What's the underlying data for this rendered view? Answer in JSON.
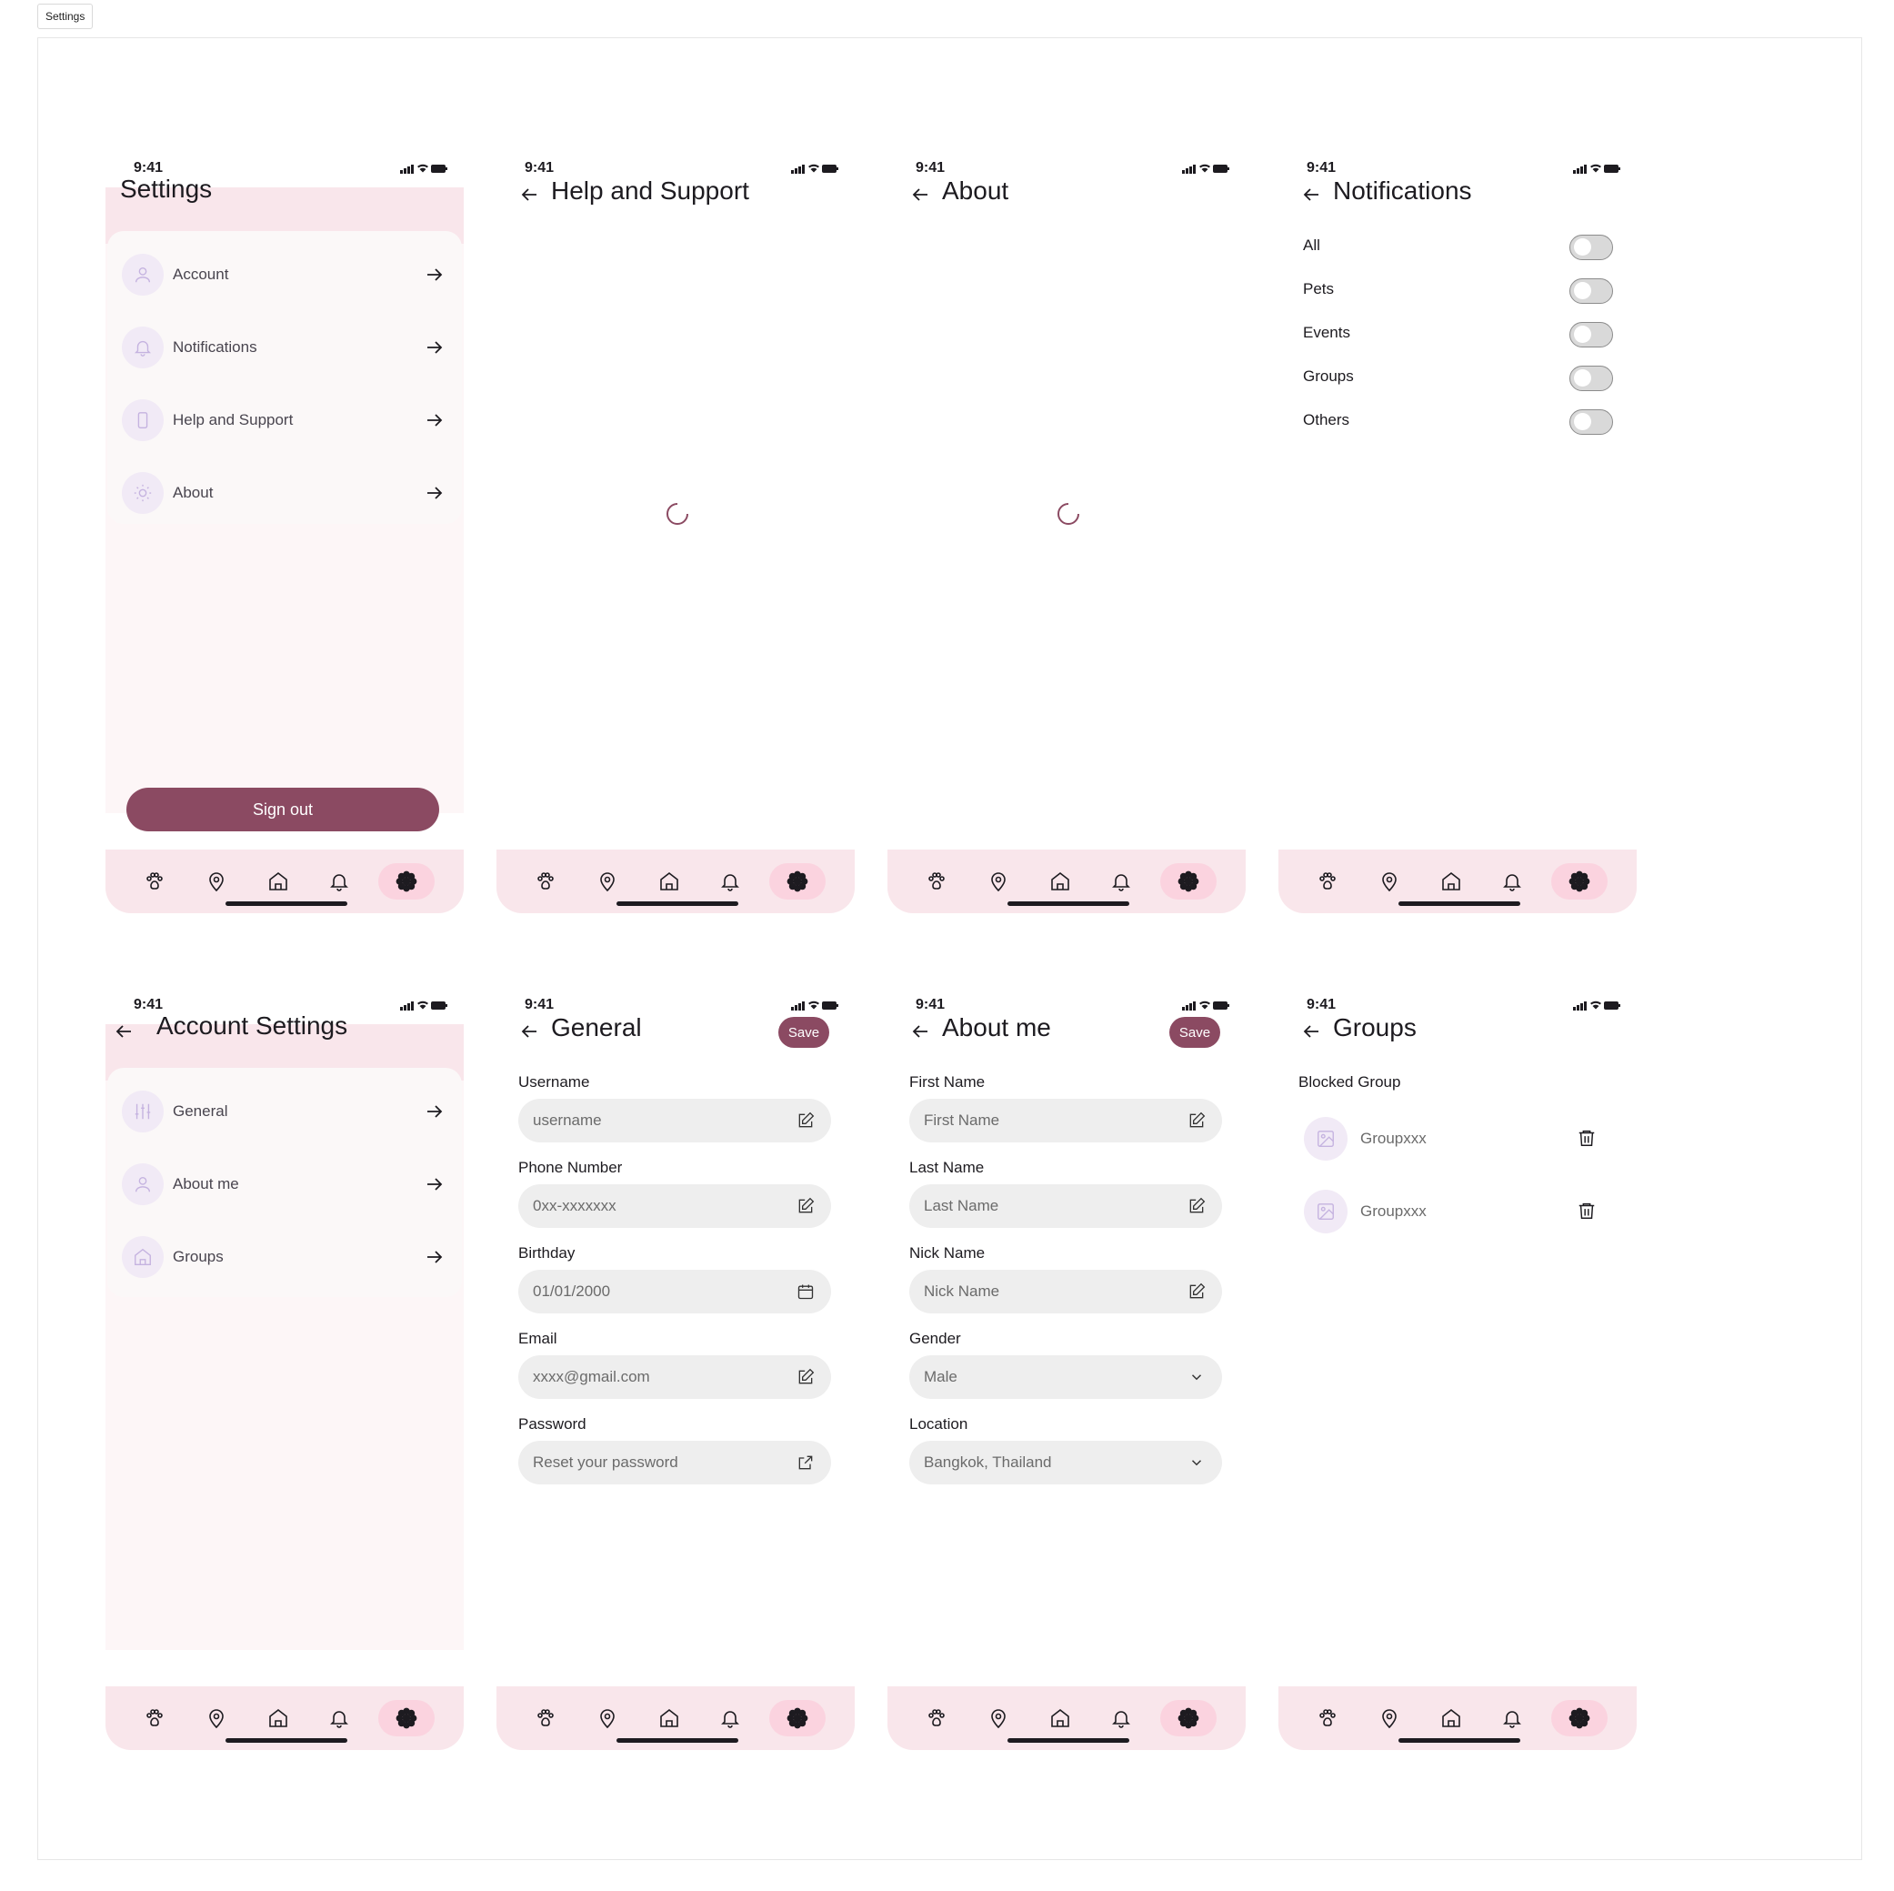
{
  "frame_label": "Settings",
  "status_time": "9:41",
  "nav_icons": [
    "paw-icon",
    "location-pin-icon",
    "home-icon",
    "bell-icon",
    "flower-icon"
  ],
  "colors": {
    "primary": "#8b4a62",
    "header_bg": "#f9e6eb",
    "page_bg": "#fdf6f7",
    "icon_bg": "#f1eaf6",
    "active_nav": "#fbd3df"
  },
  "settings": {
    "title": "Settings",
    "items": [
      {
        "label": "Account",
        "icon": "person-icon"
      },
      {
        "label": "Notifications",
        "icon": "bell-icon"
      },
      {
        "label": "Help and Support",
        "icon": "phone-icon"
      },
      {
        "label": "About",
        "icon": "sun-icon"
      }
    ],
    "signout": "Sign out"
  },
  "help": {
    "title": "Help and Support"
  },
  "about": {
    "title": "About"
  },
  "notifications": {
    "title": "Notifications",
    "toggles": [
      {
        "label": "All",
        "on": false
      },
      {
        "label": "Pets",
        "on": false
      },
      {
        "label": "Events",
        "on": false
      },
      {
        "label": "Groups",
        "on": false
      },
      {
        "label": "Others",
        "on": false
      }
    ]
  },
  "account": {
    "title": "Account Settings",
    "items": [
      {
        "label": "General",
        "icon": "sliders-icon"
      },
      {
        "label": "About me",
        "icon": "person-icon"
      },
      {
        "label": "Groups",
        "icon": "home-icon"
      }
    ]
  },
  "general": {
    "title": "General",
    "save": "Save",
    "fields": [
      {
        "label": "Username",
        "placeholder": "username",
        "icon": "edit-icon"
      },
      {
        "label": "Phone Number",
        "placeholder": "0xx-xxxxxxx",
        "icon": "edit-icon"
      },
      {
        "label": "Birthday",
        "placeholder": "01/01/2000",
        "icon": "calendar-icon"
      },
      {
        "label": "Email",
        "placeholder": "xxxx@gmail.com",
        "icon": "edit-icon"
      },
      {
        "label": "Password",
        "placeholder": "Reset your password",
        "icon": "external-link-icon"
      }
    ]
  },
  "aboutme": {
    "title": "About me",
    "save": "Save",
    "fields": [
      {
        "label": "First Name",
        "placeholder": "First Name",
        "icon": "edit-icon"
      },
      {
        "label": "Last Name",
        "placeholder": "Last Name",
        "icon": "edit-icon"
      },
      {
        "label": "Nick Name",
        "placeholder": "Nick Name",
        "icon": "edit-icon"
      },
      {
        "label": "Gender",
        "placeholder": "Male",
        "icon": "chevron-down-icon"
      },
      {
        "label": "Location",
        "placeholder": "Bangkok, Thailand",
        "icon": "chevron-down-icon"
      }
    ]
  },
  "groups": {
    "title": "Groups",
    "subtitle": "Blocked Group",
    "items": [
      {
        "label": "Groupxxx",
        "icon": "image-icon"
      },
      {
        "label": "Groupxxx",
        "icon": "image-icon"
      }
    ]
  }
}
